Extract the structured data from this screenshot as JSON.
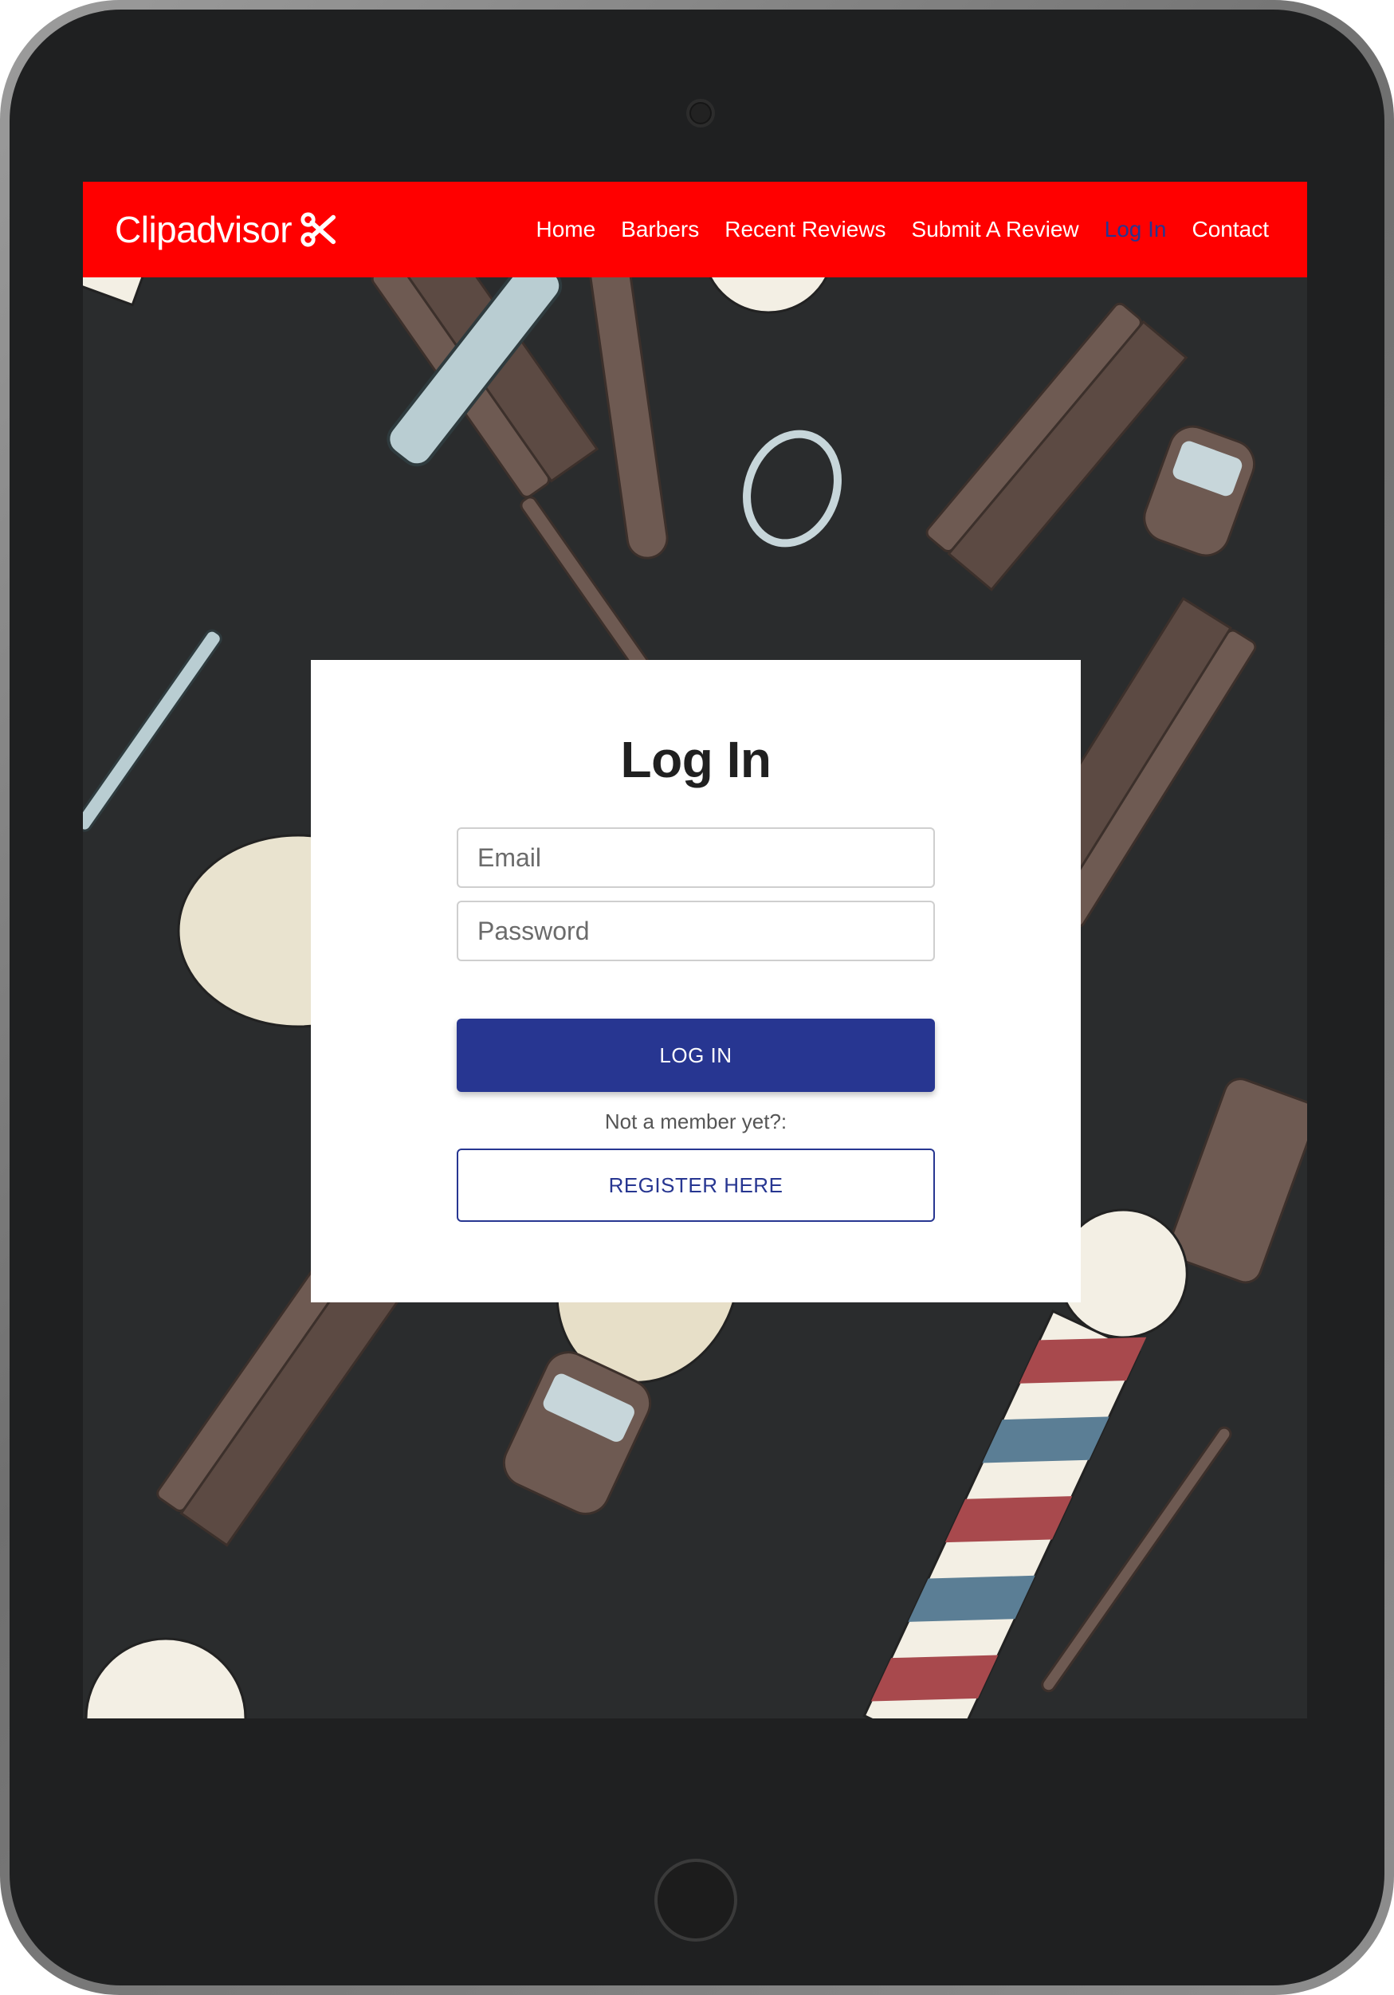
{
  "brand": {
    "name": "Clipadvisor",
    "icon": "scissors-icon"
  },
  "nav": {
    "items": [
      {
        "label": "Home",
        "active": false
      },
      {
        "label": "Barbers",
        "active": false
      },
      {
        "label": "Recent Reviews",
        "active": false
      },
      {
        "label": "Submit A Review",
        "active": false
      },
      {
        "label": "Log In",
        "active": true
      },
      {
        "label": "Contact",
        "active": false
      }
    ]
  },
  "login": {
    "title": "Log In",
    "email_placeholder": "Email",
    "password_placeholder": "Password",
    "login_label": "LOG IN",
    "member_text": "Not a member yet?:",
    "register_label": "REGISTER HERE"
  },
  "colors": {
    "navbar": "#ff0000",
    "primary": "#273691",
    "background": "#2a2c2d"
  }
}
